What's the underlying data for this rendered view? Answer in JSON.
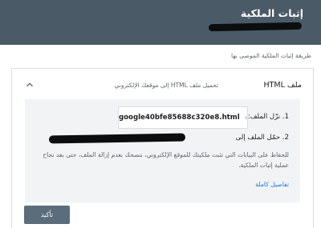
{
  "header": {
    "title": "إثبات الملكية"
  },
  "recommended_method_label": "طريقة إثبات الملكية الموصى بها",
  "method": {
    "name": "ملف HTML",
    "description": "تحميل ملف HTML إلى موقعك الإلكتروني",
    "collapse_icon": "chevron-up-icon"
  },
  "steps": {
    "step1_label": "1. نزّل الملف:",
    "download_filename": "google40bfe85688c320e8.html",
    "download_icon": "download-icon",
    "step2_label": "2. حمّل الملف إلى"
  },
  "note": "للحفاظ على البيانات التي تثبت ملكيتك للموقع الإلكتروني، ننصحك بعدم إزالة الملف، حتى بعد نجاح عملية إثبات الملكية.",
  "details_link": "تفاصيل كاملة",
  "verify_button": "تأكيد",
  "colors": {
    "header_bg": "#4a5a67",
    "panel_bg": "#f1f3f4",
    "link": "#1a73e8",
    "verify_bg": "#5b6d7a"
  }
}
